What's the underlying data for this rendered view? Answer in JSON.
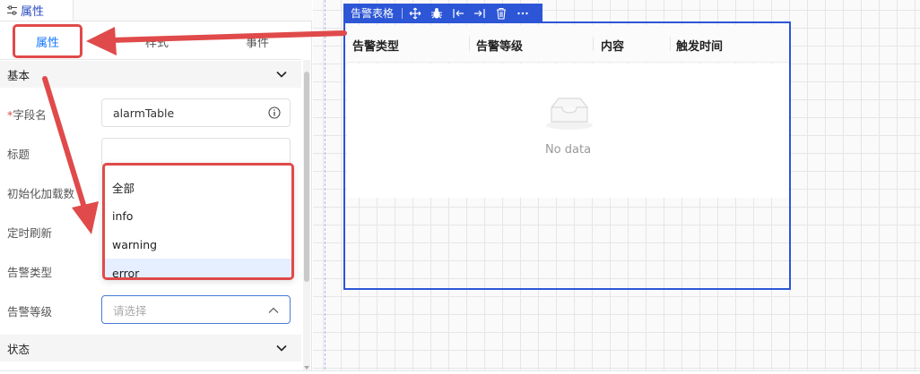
{
  "panel_tab": {
    "label": "属性",
    "icon": "sliders-icon"
  },
  "tabs": {
    "attr_label": "属性",
    "style_label": "样式",
    "event_label": "事件"
  },
  "sections": {
    "basic": "基本",
    "state": "状态"
  },
  "form": {
    "field_name_label": "字段名",
    "field_name_value": "alarmTable",
    "title_label": "标题",
    "title_value": "",
    "init_load_label": "初始化加载数",
    "timer_refresh_label": "定时刷新",
    "alarm_type_label": "告警类型",
    "alarm_level_label": "告警等级",
    "alarm_level_placeholder": "请选择"
  },
  "dropdown": {
    "options": [
      "全部",
      "info",
      "warning",
      "error"
    ],
    "selected": "error"
  },
  "component": {
    "toolbar_name": "告警表格",
    "toolbar_icons": [
      "move-icon",
      "bug-icon",
      "align-left-icon",
      "align-right-icon",
      "trash-icon",
      "more-icon"
    ],
    "columns": [
      "告警类型",
      "告警等级",
      "内容",
      "触发时间"
    ],
    "empty_text": "No data"
  },
  "colors": {
    "accent": "#1677ff",
    "component_border": "#2c56d6",
    "annotation": "#e04a4a"
  }
}
